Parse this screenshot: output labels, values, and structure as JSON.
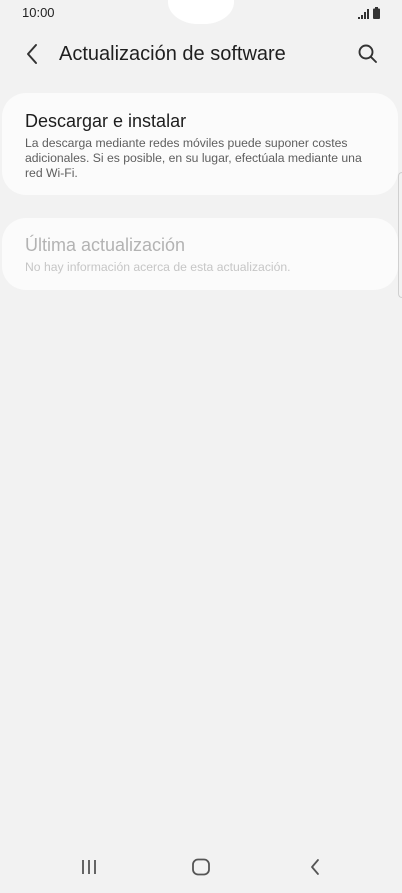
{
  "status_bar": {
    "time": "10:00",
    "icons": [
      "signal-icon",
      "battery-icon"
    ]
  },
  "app_bar": {
    "title": "Actualización de software",
    "back_icon": "chevron-left-icon",
    "search_icon": "search-icon"
  },
  "cards": {
    "download": {
      "title": "Descargar e instalar",
      "description": "La descarga mediante redes móviles puede suponer costes adicionales. Si es posible, en su lugar, efectúala mediante una red Wi-Fi."
    },
    "last_update": {
      "title": "Última actualización",
      "description": "No hay información acerca de esta actualización."
    }
  },
  "nav_bar": {
    "icons": [
      "recents-icon",
      "home-icon",
      "back-icon"
    ]
  },
  "colors": {
    "background": "#f2f2f2",
    "card": "#fbfbfb",
    "text_primary": "#1d1d1d",
    "text_secondary": "#5e5e5e",
    "text_disabled": "#b3b3b3"
  }
}
